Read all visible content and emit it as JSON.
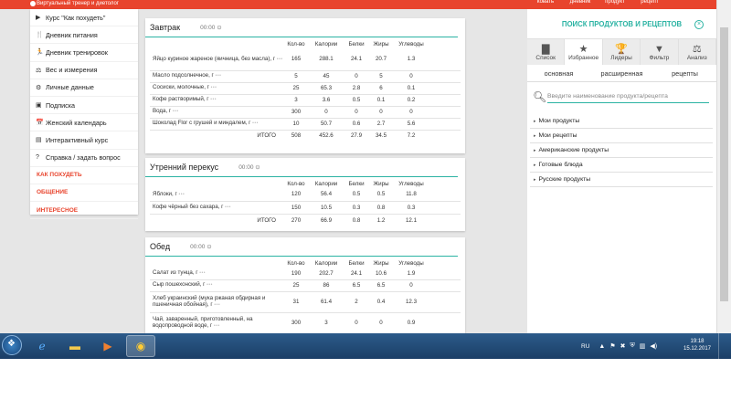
{
  "topbar": {
    "brand_subtitle": "Виртуальный тренер и диетолог",
    "nav": [
      "ковать",
      "дневник",
      "продукт",
      "рецепт"
    ]
  },
  "menu": {
    "items": [
      {
        "icon": "▶",
        "label": "Курс \"Как похудеть\""
      },
      {
        "icon": "🍴",
        "label": "Дневник питания"
      },
      {
        "icon": "🏃",
        "label": "Дневник тренировок"
      },
      {
        "icon": "⚖",
        "label": "Вес и измерения"
      },
      {
        "icon": "⚙",
        "label": "Личные данные"
      },
      {
        "icon": "▣",
        "label": "Подписка"
      },
      {
        "icon": "📅",
        "label": "Женский календарь"
      },
      {
        "icon": "▤",
        "label": "Интерактивный курс"
      },
      {
        "icon": "?",
        "label": "Справка / задать вопрос"
      }
    ],
    "links": [
      "КАК ПОХУДЕТЬ",
      "ОБЩЕНИЕ",
      "ИНТЕРЕСНОЕ"
    ]
  },
  "columns": [
    "Кол-во",
    "Калории",
    "Белки",
    "Жиры",
    "Углеводы"
  ],
  "meals": [
    {
      "title": "Завтрак",
      "time": "00:00",
      "rows": [
        {
          "name": "Яйцо куриное жареное (яичница, без масла), г",
          "vals": [
            "165",
            "288.1",
            "24.1",
            "20.7",
            "1.3"
          ]
        },
        {
          "name": "Масло подсолнечное, г",
          "vals": [
            "5",
            "45",
            "0",
            "5",
            "0"
          ]
        },
        {
          "name": "Сосиски, молочные, г",
          "vals": [
            "25",
            "65.3",
            "2.8",
            "6",
            "0.1"
          ]
        },
        {
          "name": "Кофе растворимый, г",
          "vals": [
            "3",
            "3.6",
            "0.5",
            "0.1",
            "0.2"
          ]
        },
        {
          "name": "Вода, г",
          "vals": [
            "300",
            "0",
            "0",
            "0",
            "0"
          ]
        },
        {
          "name": "Шоколад Flor с грушей и миндалем, г",
          "vals": [
            "10",
            "50.7",
            "0.6",
            "2.7",
            "5.6"
          ]
        }
      ],
      "total": {
        "label": "ИТОГО",
        "vals": [
          "508",
          "452.6",
          "27.9",
          "34.5",
          "7.2"
        ]
      }
    },
    {
      "title": "Утренний перекус",
      "time": "00:00",
      "rows": [
        {
          "name": "Яблоки, г",
          "vals": [
            "120",
            "56.4",
            "0.5",
            "0.5",
            "11.8"
          ]
        },
        {
          "name": "Кофе чёрный без сахара, г",
          "vals": [
            "150",
            "10.5",
            "0.3",
            "0.8",
            "0.3"
          ]
        }
      ],
      "total": {
        "label": "ИТОГО",
        "vals": [
          "270",
          "66.9",
          "0.8",
          "1.2",
          "12.1"
        ]
      }
    },
    {
      "title": "Обед",
      "time": "00:00",
      "rows": [
        {
          "name": "Салат из тунца, г",
          "vals": [
            "190",
            "202.7",
            "24.1",
            "10.6",
            "1.9"
          ]
        },
        {
          "name": "Сыр пошехонский, г",
          "vals": [
            "25",
            "86",
            "6.5",
            "6.5",
            "0"
          ]
        },
        {
          "name": "Хлеб украинский (мука ржаная обдирная и пшеничная обойная), г",
          "vals": [
            "31",
            "61.4",
            "2",
            "0.4",
            "12.3"
          ]
        },
        {
          "name": "Чай, заваренный, приготовленный, на водопроводной воде, г",
          "vals": [
            "300",
            "3",
            "0",
            "0",
            "0.9"
          ]
        }
      ]
    }
  ],
  "right": {
    "title": "ПОИСК ПРОДУКТОВ И РЕЦЕПТОВ",
    "close": "×",
    "tabs": [
      {
        "icon": "▇",
        "label": "Список"
      },
      {
        "icon": "★",
        "label": "Избранное"
      },
      {
        "icon": "🏆",
        "label": "Лидеры"
      },
      {
        "icon": "▼",
        "label": "Фильтр"
      },
      {
        "icon": "⚖",
        "label": "Анализ"
      }
    ],
    "subtabs": [
      "основная",
      "расширенная",
      "рецепты"
    ],
    "search_placeholder": "Введите наименование продукта/рецепта",
    "list": [
      "Мои продукты",
      "Мои рецепты",
      "Американские продукты",
      "Готовые блюда",
      "Русские продукты"
    ]
  },
  "taskbar": {
    "lang": "RU",
    "time": "19:18",
    "date": "15.12.2017"
  }
}
